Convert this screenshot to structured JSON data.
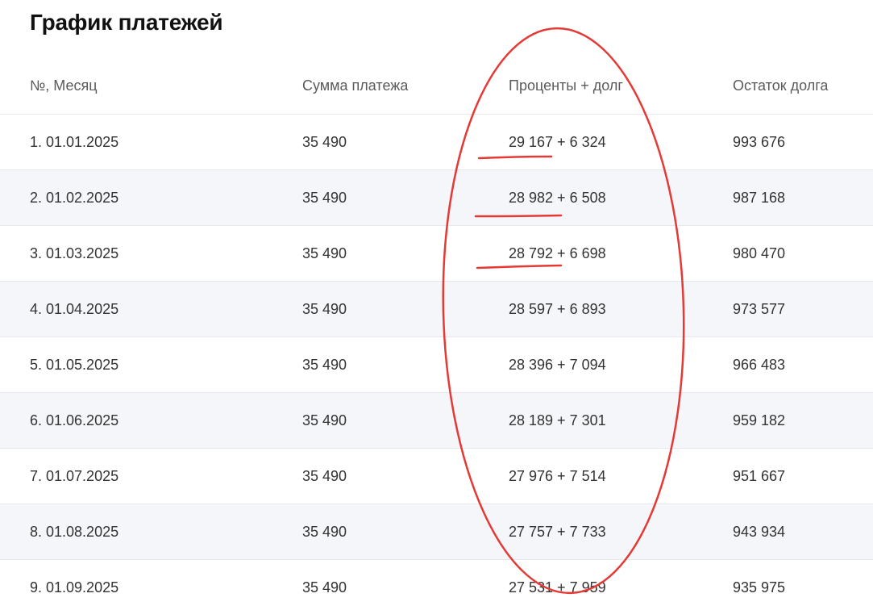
{
  "page": {
    "title": "График платежей"
  },
  "table": {
    "headers": {
      "month": "№, Месяц",
      "payment": "Сумма платежа",
      "interest_debt": "Проценты + долг",
      "balance": "Остаток долга"
    },
    "rows": [
      {
        "month": "1. 01.01.2025",
        "payment": "35 490",
        "interest_debt": "29 167 + 6 324",
        "balance": "993 676"
      },
      {
        "month": "2. 01.02.2025",
        "payment": "35 490",
        "interest_debt": "28 982 + 6 508",
        "balance": "987 168"
      },
      {
        "month": "3. 01.03.2025",
        "payment": "35 490",
        "interest_debt": "28 792 + 6 698",
        "balance": "980 470"
      },
      {
        "month": "4. 01.04.2025",
        "payment": "35 490",
        "interest_debt": "28 597 + 6 893",
        "balance": "973 577"
      },
      {
        "month": "5. 01.05.2025",
        "payment": "35 490",
        "interest_debt": "28 396 + 7 094",
        "balance": "966 483"
      },
      {
        "month": "6. 01.06.2025",
        "payment": "35 490",
        "interest_debt": "28 189 + 7 301",
        "balance": "959 182"
      },
      {
        "month": "7. 01.07.2025",
        "payment": "35 490",
        "interest_debt": "27 976 + 7 514",
        "balance": "951 667"
      },
      {
        "month": "8. 01.08.2025",
        "payment": "35 490",
        "interest_debt": "27 757 + 7 733",
        "balance": "943 934"
      },
      {
        "month": "9. 01.09.2025",
        "payment": "35 490",
        "interest_debt": "27 531 + 7 959",
        "balance": "935 975"
      }
    ]
  },
  "colors": {
    "annotation": "#e53935",
    "row_alt_bg": "#f4f6f9",
    "divider": "#e6e8ec"
  }
}
